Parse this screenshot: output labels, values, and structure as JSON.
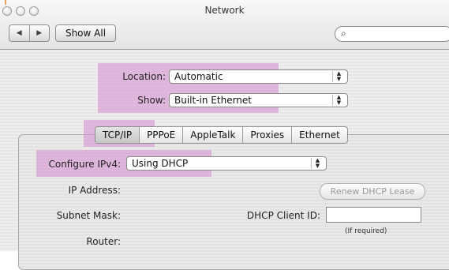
{
  "window": {
    "title": "Network"
  },
  "toolbar": {
    "back_icon": "◀",
    "forward_icon": "▶",
    "show_all_label": "Show All",
    "search_icon": "⌕",
    "search_value": ""
  },
  "location": {
    "label": "Location:",
    "value": "Automatic"
  },
  "show": {
    "label": "Show:",
    "value": "Built-in Ethernet"
  },
  "tabs": [
    {
      "label": "TCP/IP",
      "active": true
    },
    {
      "label": "PPPoE",
      "active": false
    },
    {
      "label": "AppleTalk",
      "active": false
    },
    {
      "label": "Proxies",
      "active": false
    },
    {
      "label": "Ethernet",
      "active": false
    }
  ],
  "tcpip": {
    "configure_label": "Configure IPv4:",
    "configure_value": "Using DHCP",
    "ip_address_label": "IP Address:",
    "subnet_mask_label": "Subnet Mask:",
    "router_label": "Router:",
    "renew_button_label": "Renew DHCP Lease",
    "dhcp_client_id_label": "DHCP Client ID:",
    "dhcp_client_id_value": "",
    "if_required_note": "(If required)"
  },
  "colors": {
    "highlight": "#d696d2"
  }
}
